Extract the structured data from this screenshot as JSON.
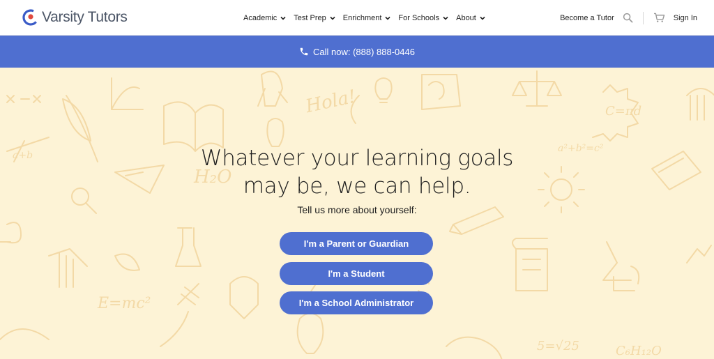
{
  "header": {
    "brand": "Varsity Tutors",
    "menu": [
      {
        "label": "Academic"
      },
      {
        "label": "Test Prep"
      },
      {
        "label": "Enrichment"
      },
      {
        "label": "For Schools"
      },
      {
        "label": "About"
      }
    ],
    "become_tutor": "Become a Tutor",
    "sign_in": "Sign In",
    "icons": [
      "search-icon",
      "cart-icon",
      "chevron-down-icon"
    ]
  },
  "call_bar": {
    "text": "Call now: (888) 888-0446",
    "icon": "phone-icon",
    "color": "#4f6fd0"
  },
  "hero": {
    "headline": "Whatever your learning goals may be, we can help.",
    "subhead": "Tell us more about yourself:",
    "buttons": [
      {
        "label": "I'm a Parent or Guardian"
      },
      {
        "label": "I'm a Student"
      },
      {
        "label": "I'm a School Administrator"
      }
    ],
    "background": "#fdf3d6",
    "doodle_words": [
      "Hola!",
      "a²+b²=c²",
      "C=πd",
      "5=√25",
      "H₂O"
    ]
  }
}
